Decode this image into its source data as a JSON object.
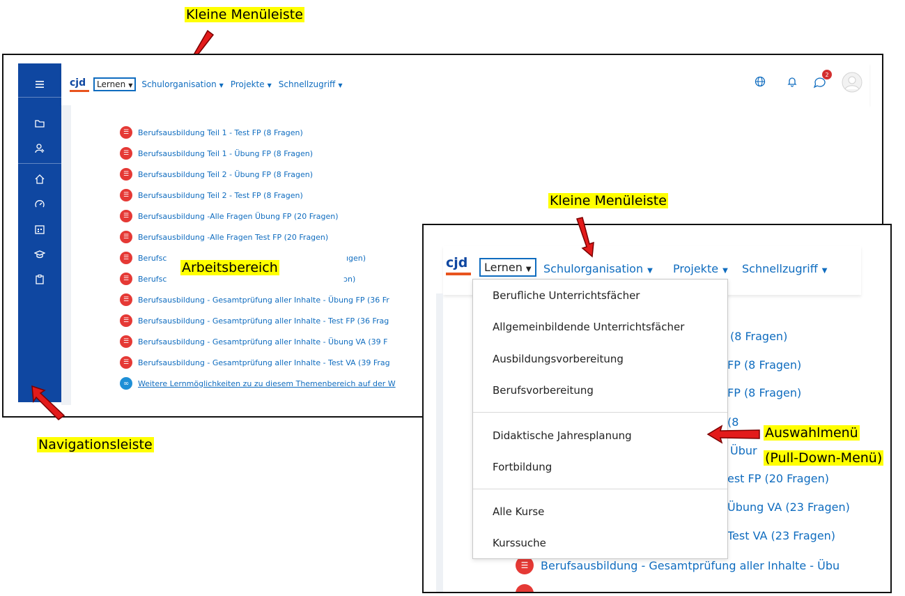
{
  "callouts": {
    "top_menubar": "Kleine Menüleiste",
    "zoom_menubar": "Kleine Menüleiste",
    "workarea": "Arbeitsbereich",
    "navbar": "Navigationsleiste",
    "select_menu_line1": "Auswahlmenü",
    "select_menu_line2": "(Pull-Down-Menü)"
  },
  "topbar": {
    "logo": "cjd",
    "menu": [
      {
        "label": "Lernen",
        "active": true
      },
      {
        "label": "Schulorganisation"
      },
      {
        "label": "Projekte"
      },
      {
        "label": "Schnellzugriff"
      }
    ],
    "notification_count": "2",
    "icons": [
      "globe-icon",
      "bell-icon",
      "chat-icon",
      "avatar"
    ]
  },
  "sidebar": {
    "icons": [
      "menu-icon",
      "folder-icon",
      "participants-icon",
      "home-icon",
      "dashboard-icon",
      "calendar-icon",
      "graduation-cap-icon",
      "clipboard-icon"
    ]
  },
  "courses": [
    "Berufsausbildung Teil 1 - Test FP (8 Fragen)",
    "Berufsausbildung Teil 1 - Übung FP (8 Fragen)",
    "Berufsausbildung Teil 2 - Übung FP (8 Fragen)",
    "Berufsausbildung Teil 2 - Test FP (8 Fragen)",
    "Berufsausbildung -Alle Fragen Übung FP (20 Fragen)",
    "Berufsausbildung -Alle Fragen Test FP (20 Fragen)",
    "Berufsc",
    "Berufsc",
    "Berufsausbildung - Gesamtprüfung aller Inhalte - Übung FP (36 Fr",
    "Berufsausbildung - Gesamtprüfung aller Inhalte - Test FP (36 Frag",
    "Berufsausbildung - Gesamtprüfung aller Inhalte - Übung VA (39 F",
    "Berufsausbildung - Gesamtprüfung aller Inhalte - Test VA (39 Frag"
  ],
  "course_fragments": [
    "ıgen)",
    "ɔn)"
  ],
  "more_link": "Weitere Lernmöglichkeiten zu zu diesem Themenbereich auf der W",
  "zoom": {
    "menu": [
      "Lernen",
      "Schulorganisation",
      "Projekte",
      "Schnellzugriff"
    ],
    "dropdown": [
      "Berufliche Unterrichtsfächer",
      "Allgemeinbildende Unterrichtsfächer",
      "Ausbildungsvorbereitung",
      "Berufsvorbereitung",
      "Didaktische Jahresplanung",
      "Fortbildung",
      "Alle Kurse",
      "Kurssuche"
    ],
    "background_fragments": [
      "(8 Fragen)",
      "FP (8 Fragen)",
      "FP (8 Fragen)",
      "(8",
      "Übur",
      "est FP (20 Fragen)",
      "Übung VA (23 Fragen)",
      "Test VA (23 Fragen)"
    ],
    "bottom_row": "Berufsausbildung - Gesamtprüfung aller Inhalte - Übu"
  }
}
